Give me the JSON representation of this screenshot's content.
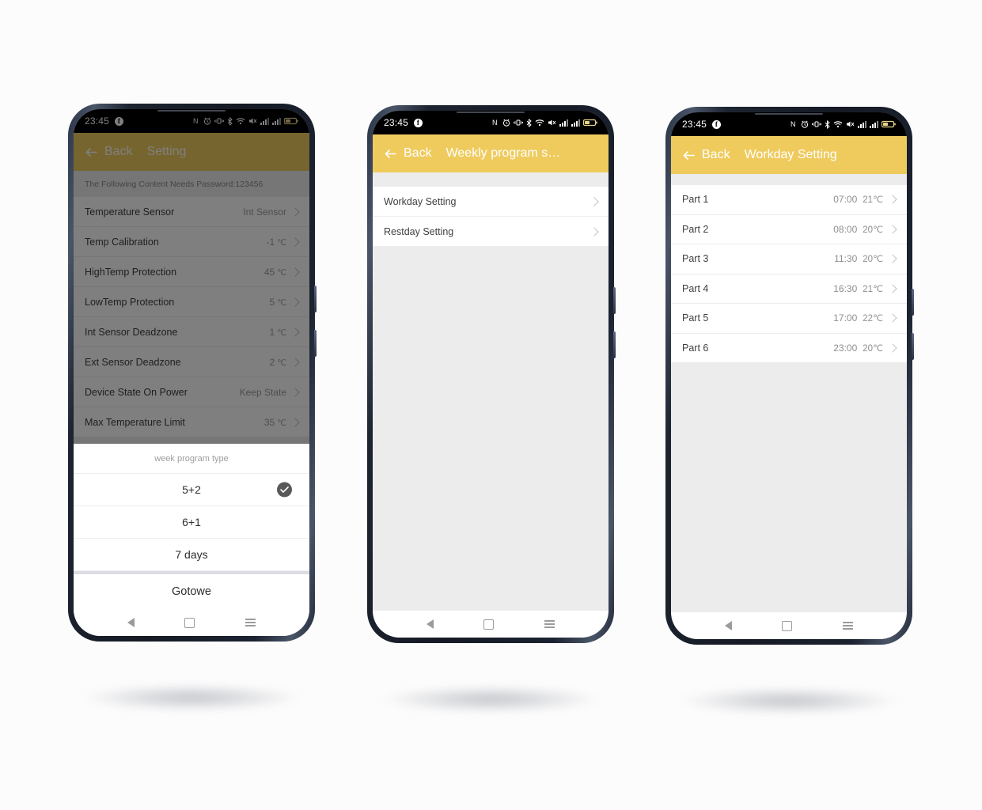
{
  "page": {
    "background_color": "#fcfcfc",
    "accent_color": "#efcb5e",
    "dim_color": "rgba(0,0,0,0.5)"
  },
  "status_bar": {
    "time": "23:45",
    "facebook_glyph": "f",
    "icons": [
      "nfc-icon",
      "alarm-icon",
      "vibrate-icon",
      "bluetooth-icon",
      "wifi-icon",
      "mute-icon",
      "signal-1-icon",
      "signal-2-icon",
      "battery-icon"
    ]
  },
  "nav_bar": {
    "back_label": "back",
    "home_label": "home",
    "recents_label": "recents"
  },
  "phone1": {
    "appbar": {
      "back_label": "Back",
      "title": "Setting"
    },
    "note": "The Following Content Needs Password:123456",
    "rows": [
      {
        "label": "Temperature Sensor",
        "value": "Int Sensor",
        "unit": ""
      },
      {
        "label": "Temp Calibration",
        "value": "-1",
        "unit": "℃"
      },
      {
        "label": "HighTemp Protection",
        "value": "45",
        "unit": "℃"
      },
      {
        "label": "LowTemp Protection",
        "value": "5",
        "unit": "℃"
      },
      {
        "label": "Int Sensor Deadzone",
        "value": "1",
        "unit": "℃"
      },
      {
        "label": "Ext Sensor Deadzone",
        "value": "2",
        "unit": "℃"
      },
      {
        "label": "Device State On Power",
        "value": "Keep State",
        "unit": ""
      },
      {
        "label": "Max Temperature Limit",
        "value": "35",
        "unit": "℃"
      }
    ],
    "sheet": {
      "title": "week program type",
      "options": [
        {
          "label": "5+2",
          "selected": true
        },
        {
          "label": "6+1",
          "selected": false
        },
        {
          "label": "7 days",
          "selected": false
        }
      ],
      "done_label": "Gotowe"
    }
  },
  "phone2": {
    "appbar": {
      "back_label": "Back",
      "title": "Weekly program s…"
    },
    "rows": [
      {
        "label": "Workday Setting"
      },
      {
        "label": "Restday Setting"
      }
    ]
  },
  "phone3": {
    "appbar": {
      "back_label": "Back",
      "title": "Workday Setting"
    },
    "rows": [
      {
        "label": "Part 1",
        "time": "07:00",
        "temp": "21℃"
      },
      {
        "label": "Part 2",
        "time": "08:00",
        "temp": "20℃"
      },
      {
        "label": "Part 3",
        "time": "11:30",
        "temp": "20℃"
      },
      {
        "label": "Part 4",
        "time": "16:30",
        "temp": "21℃"
      },
      {
        "label": "Part 5",
        "time": "17:00",
        "temp": "22℃"
      },
      {
        "label": "Part 6",
        "time": "23:00",
        "temp": "20℃"
      }
    ]
  }
}
